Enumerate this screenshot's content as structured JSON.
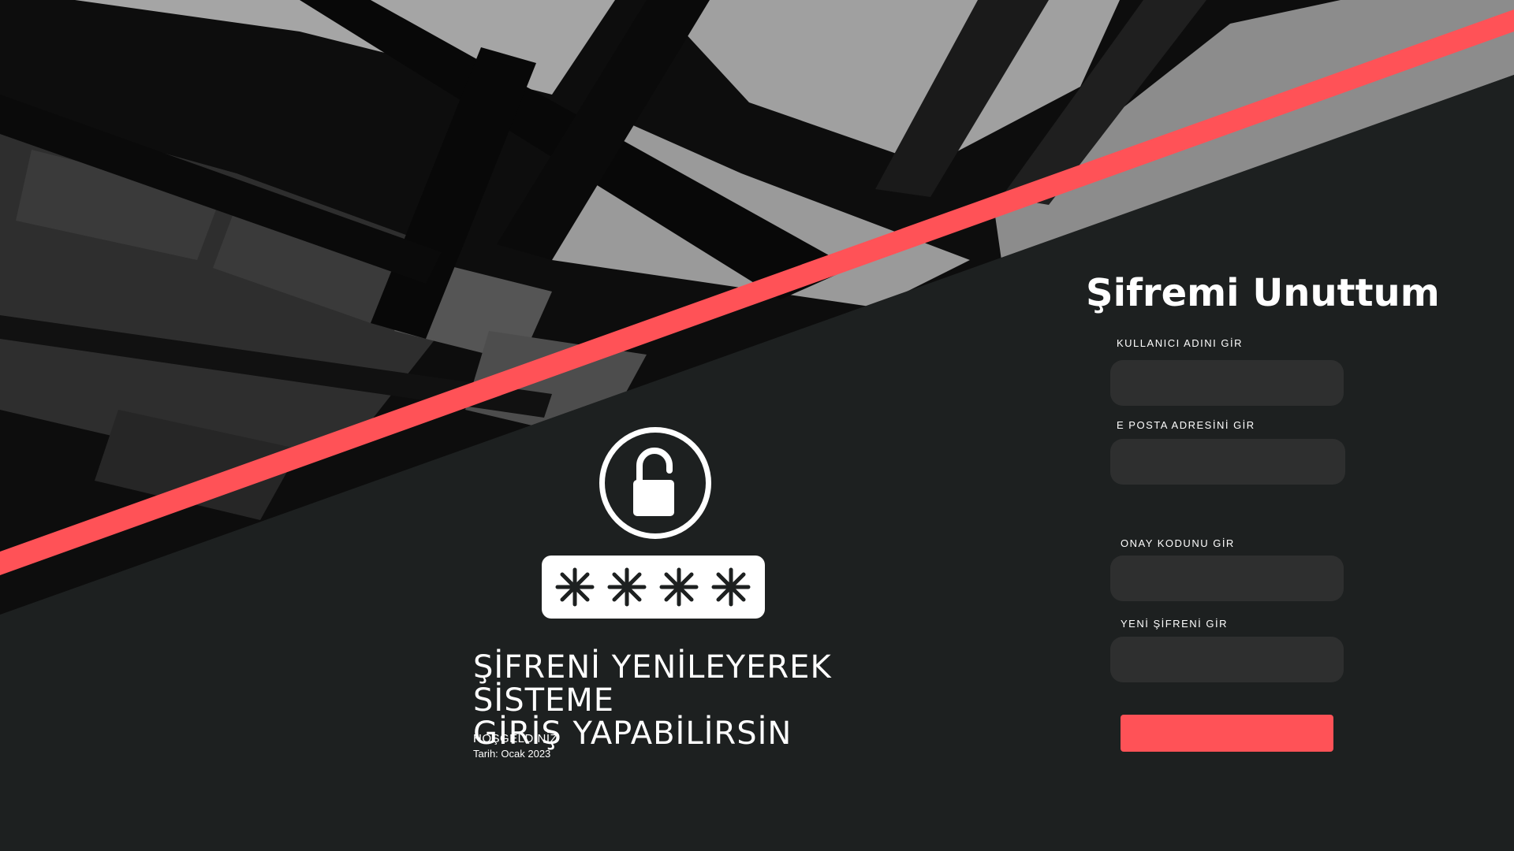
{
  "colors": {
    "background": "#1d2020",
    "accent": "#ff5257",
    "input_bg": "#2e2f2f",
    "text": "#ffffff"
  },
  "hero": {
    "lock_icon": "unlocked-padlock-icon",
    "pin_icon": "asterisk-icon",
    "pin_masked_count": 4,
    "headline_line1": "ŞİFRENİ YENİLEYEREK SİSTEME",
    "headline_line2": "GİRİŞ YAPABİLİRSİN",
    "welcome": "HOŞGELDİNİZ",
    "date": "Tarih: Ocak 2023"
  },
  "form": {
    "title": "Şifremi Unuttum",
    "username_label": "KULLANICI ADINI GİR",
    "username_value": "",
    "email_label": "E POSTA ADRESİNİ GİR",
    "email_value": "",
    "code_label": "ONAY KODUNU GİR",
    "code_value": "",
    "new_password_label": "YENİ ŞİFRENİ GİR",
    "new_password_value": "",
    "submit_label": ""
  }
}
